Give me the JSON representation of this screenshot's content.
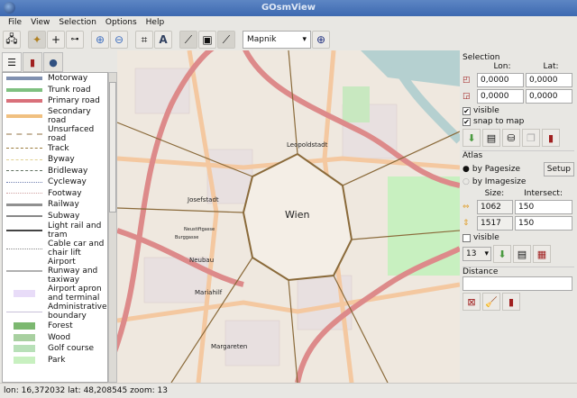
{
  "window": {
    "title": "GOsmView"
  },
  "menu": [
    "File",
    "View",
    "Selection",
    "Options",
    "Help"
  ],
  "toolbar": {
    "map_source": "Mapnik",
    "buttons": [
      "connect-icon",
      "navigate-icon",
      "crosshair-icon",
      "route-icon",
      "zoom-in-icon",
      "zoom-out-icon",
      "select-area-icon",
      "label-icon",
      "draw-line-icon",
      "screenshot-icon",
      "measure-icon",
      "projection-icon"
    ]
  },
  "left_tabs": [
    "legend-tab",
    "bookmarks-tab",
    "globe-tab"
  ],
  "legend": [
    {
      "label": "Motorway",
      "color": "#8090b0",
      "style": "solid",
      "w": 4
    },
    {
      "label": "Trunk road",
      "color": "#7fc080",
      "style": "solid",
      "w": 4
    },
    {
      "label": "Primary road",
      "color": "#d9707a",
      "style": "solid",
      "w": 4
    },
    {
      "label": "Secondary road",
      "color": "#f0c080",
      "style": "solid",
      "w": 4
    },
    {
      "label": "Unsurfaced road",
      "color": "#c8b8a0",
      "style": "dashed",
      "w": 2
    },
    {
      "label": "Track",
      "color": "#9a7b3c",
      "style": "dashed",
      "w": 1.5
    },
    {
      "label": "Byway",
      "color": "#e0d090",
      "style": "dashed",
      "w": 1.5
    },
    {
      "label": "Bridleway",
      "color": "#607060",
      "style": "dashed",
      "w": 1
    },
    {
      "label": "Cycleway",
      "color": "#7080b0",
      "style": "dotted",
      "w": 1
    },
    {
      "label": "Footway",
      "color": "#d0a0a0",
      "style": "dotted",
      "w": 1
    },
    {
      "label": "Railway",
      "color": "#909090",
      "style": "solid",
      "w": 3
    },
    {
      "label": "Subway",
      "color": "#888888",
      "style": "solid",
      "w": 2
    },
    {
      "label": "Light rail and tram",
      "color": "#444444",
      "style": "solid",
      "w": 2
    },
    {
      "label": "Cable car and chair lift",
      "color": "#888888",
      "style": "dotted",
      "w": 1
    },
    {
      "label": "Airport Runway and taxiway",
      "color": "#b0b0b0",
      "style": "solid",
      "w": 2
    },
    {
      "label": "Airport apron and terminal",
      "color": "#e8dcf8",
      "style": "block",
      "w": 8
    },
    {
      "label": "Administrative boundary",
      "color": "#c8c0d8",
      "style": "solid",
      "w": 1
    },
    {
      "label": "Forest",
      "color": "#7cb870",
      "style": "block",
      "w": 8
    },
    {
      "label": "Wood",
      "color": "#a8d0a0",
      "style": "block",
      "w": 8
    },
    {
      "label": "Golf course",
      "color": "#b8e0b8",
      "style": "block",
      "w": 8
    },
    {
      "label": "Park",
      "color": "#c8f0c0",
      "style": "block",
      "w": 8
    }
  ],
  "map": {
    "labels": [
      "Wien",
      "Leopoldstadt",
      "Josefstadt",
      "Neubau",
      "Mariahilf",
      "Margareten",
      "Neustiftgasse",
      "Burggasse"
    ]
  },
  "selection": {
    "title": "Selection",
    "lon_label": "Lon:",
    "lat_label": "Lat:",
    "top_left": {
      "lon": "0,0000",
      "lat": "0,0000"
    },
    "bottom_right": {
      "lon": "0,0000",
      "lat": "0,0000"
    },
    "visible_label": "visible",
    "visible": true,
    "snap_label": "snap to map",
    "snap": true
  },
  "atlas": {
    "title": "Atlas",
    "by_pagesize": "by Pagesize",
    "by_imagesize": "by Imagesize",
    "setup_label": "Setup",
    "size_label": "Size:",
    "intersect_label": "Intersect:",
    "width": "1062",
    "height": "1517",
    "intersect_w": "150",
    "intersect_h": "150",
    "visible_label": "visible",
    "visible": false,
    "zoom": "13"
  },
  "distance": {
    "title": "Distance",
    "value": ""
  },
  "status": {
    "text": "lon: 16,372032 lat: 48,208545 zoom: 13"
  }
}
